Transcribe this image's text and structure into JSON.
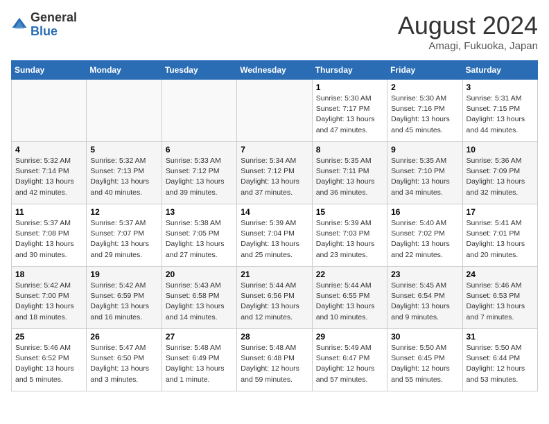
{
  "logo": {
    "general": "General",
    "blue": "Blue"
  },
  "title": "August 2024",
  "location": "Amagi, Fukuoka, Japan",
  "weekdays": [
    "Sunday",
    "Monday",
    "Tuesday",
    "Wednesday",
    "Thursday",
    "Friday",
    "Saturday"
  ],
  "weeks": [
    [
      {
        "day": "",
        "info": ""
      },
      {
        "day": "",
        "info": ""
      },
      {
        "day": "",
        "info": ""
      },
      {
        "day": "",
        "info": ""
      },
      {
        "day": "1",
        "info": "Sunrise: 5:30 AM\nSunset: 7:17 PM\nDaylight: 13 hours\nand 47 minutes."
      },
      {
        "day": "2",
        "info": "Sunrise: 5:30 AM\nSunset: 7:16 PM\nDaylight: 13 hours\nand 45 minutes."
      },
      {
        "day": "3",
        "info": "Sunrise: 5:31 AM\nSunset: 7:15 PM\nDaylight: 13 hours\nand 44 minutes."
      }
    ],
    [
      {
        "day": "4",
        "info": "Sunrise: 5:32 AM\nSunset: 7:14 PM\nDaylight: 13 hours\nand 42 minutes."
      },
      {
        "day": "5",
        "info": "Sunrise: 5:32 AM\nSunset: 7:13 PM\nDaylight: 13 hours\nand 40 minutes."
      },
      {
        "day": "6",
        "info": "Sunrise: 5:33 AM\nSunset: 7:12 PM\nDaylight: 13 hours\nand 39 minutes."
      },
      {
        "day": "7",
        "info": "Sunrise: 5:34 AM\nSunset: 7:12 PM\nDaylight: 13 hours\nand 37 minutes."
      },
      {
        "day": "8",
        "info": "Sunrise: 5:35 AM\nSunset: 7:11 PM\nDaylight: 13 hours\nand 36 minutes."
      },
      {
        "day": "9",
        "info": "Sunrise: 5:35 AM\nSunset: 7:10 PM\nDaylight: 13 hours\nand 34 minutes."
      },
      {
        "day": "10",
        "info": "Sunrise: 5:36 AM\nSunset: 7:09 PM\nDaylight: 13 hours\nand 32 minutes."
      }
    ],
    [
      {
        "day": "11",
        "info": "Sunrise: 5:37 AM\nSunset: 7:08 PM\nDaylight: 13 hours\nand 30 minutes."
      },
      {
        "day": "12",
        "info": "Sunrise: 5:37 AM\nSunset: 7:07 PM\nDaylight: 13 hours\nand 29 minutes."
      },
      {
        "day": "13",
        "info": "Sunrise: 5:38 AM\nSunset: 7:05 PM\nDaylight: 13 hours\nand 27 minutes."
      },
      {
        "day": "14",
        "info": "Sunrise: 5:39 AM\nSunset: 7:04 PM\nDaylight: 13 hours\nand 25 minutes."
      },
      {
        "day": "15",
        "info": "Sunrise: 5:39 AM\nSunset: 7:03 PM\nDaylight: 13 hours\nand 23 minutes."
      },
      {
        "day": "16",
        "info": "Sunrise: 5:40 AM\nSunset: 7:02 PM\nDaylight: 13 hours\nand 22 minutes."
      },
      {
        "day": "17",
        "info": "Sunrise: 5:41 AM\nSunset: 7:01 PM\nDaylight: 13 hours\nand 20 minutes."
      }
    ],
    [
      {
        "day": "18",
        "info": "Sunrise: 5:42 AM\nSunset: 7:00 PM\nDaylight: 13 hours\nand 18 minutes."
      },
      {
        "day": "19",
        "info": "Sunrise: 5:42 AM\nSunset: 6:59 PM\nDaylight: 13 hours\nand 16 minutes."
      },
      {
        "day": "20",
        "info": "Sunrise: 5:43 AM\nSunset: 6:58 PM\nDaylight: 13 hours\nand 14 minutes."
      },
      {
        "day": "21",
        "info": "Sunrise: 5:44 AM\nSunset: 6:56 PM\nDaylight: 13 hours\nand 12 minutes."
      },
      {
        "day": "22",
        "info": "Sunrise: 5:44 AM\nSunset: 6:55 PM\nDaylight: 13 hours\nand 10 minutes."
      },
      {
        "day": "23",
        "info": "Sunrise: 5:45 AM\nSunset: 6:54 PM\nDaylight: 13 hours\nand 9 minutes."
      },
      {
        "day": "24",
        "info": "Sunrise: 5:46 AM\nSunset: 6:53 PM\nDaylight: 13 hours\nand 7 minutes."
      }
    ],
    [
      {
        "day": "25",
        "info": "Sunrise: 5:46 AM\nSunset: 6:52 PM\nDaylight: 13 hours\nand 5 minutes."
      },
      {
        "day": "26",
        "info": "Sunrise: 5:47 AM\nSunset: 6:50 PM\nDaylight: 13 hours\nand 3 minutes."
      },
      {
        "day": "27",
        "info": "Sunrise: 5:48 AM\nSunset: 6:49 PM\nDaylight: 13 hours\nand 1 minute."
      },
      {
        "day": "28",
        "info": "Sunrise: 5:48 AM\nSunset: 6:48 PM\nDaylight: 12 hours\nand 59 minutes."
      },
      {
        "day": "29",
        "info": "Sunrise: 5:49 AM\nSunset: 6:47 PM\nDaylight: 12 hours\nand 57 minutes."
      },
      {
        "day": "30",
        "info": "Sunrise: 5:50 AM\nSunset: 6:45 PM\nDaylight: 12 hours\nand 55 minutes."
      },
      {
        "day": "31",
        "info": "Sunrise: 5:50 AM\nSunset: 6:44 PM\nDaylight: 12 hours\nand 53 minutes."
      }
    ]
  ]
}
